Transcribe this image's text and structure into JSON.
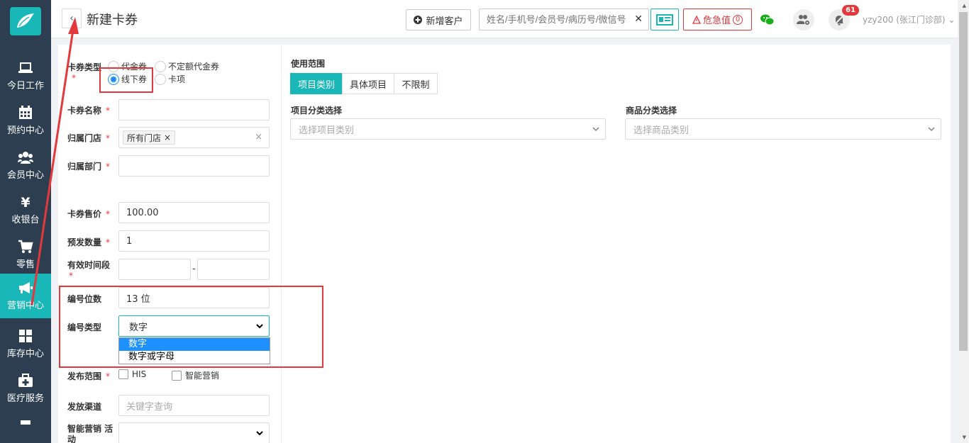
{
  "header": {
    "title": "新建卡券",
    "add_customer": "新增客户",
    "search_placeholder": "姓名/手机号/会员号/病历号/微信号",
    "critical_label": "危急值",
    "critical_count": "0",
    "notification_count": "61",
    "user": "yzy200 (张江门诊部)"
  },
  "sidebar": {
    "items": [
      {
        "label": "今日工作",
        "icon": "laptop-icon"
      },
      {
        "label": "预约中心",
        "icon": "calendar-icon"
      },
      {
        "label": "会员中心",
        "icon": "users-icon"
      },
      {
        "label": "收银台",
        "icon": "yen-icon"
      },
      {
        "label": "零售",
        "icon": "cart-icon"
      },
      {
        "label": "营销中心",
        "icon": "megaphone-icon",
        "active": true
      },
      {
        "label": "库存中心",
        "icon": "grid-icon"
      },
      {
        "label": "医疗服务",
        "icon": "medkit-icon"
      }
    ]
  },
  "form": {
    "card_type_label": "卡券类型",
    "card_types": [
      "代金券",
      "不定额代金券",
      "线下券",
      "卡项"
    ],
    "card_type_selected": "线下券",
    "name_label": "卡券名称",
    "store_label": "归属门店",
    "store_tag": "所有门店",
    "dept_label": "归属部门",
    "price_label": "卡券售价",
    "price_value": "100.00",
    "qty_label": "预发数量",
    "qty_value": "1",
    "period_label": "有效时间段",
    "period_sep": "-",
    "digits_label": "编号位数",
    "digits_value": "13 位",
    "numtype_label": "编号类型",
    "numtype_value": "数字",
    "numtype_options": [
      "数字",
      "数字或字母"
    ],
    "publish_label": "发布范围",
    "publish_options": [
      "HIS",
      "智能营销"
    ],
    "channel_label": "发放渠道",
    "channel_placeholder": "关键字查询",
    "activity_label": "智能营销 活动"
  },
  "scope": {
    "title": "使用范围",
    "tabs": [
      "项目类别",
      "具体项目",
      "不限制"
    ],
    "active_tab": "项目类别",
    "item_cat_label": "项目分类选择",
    "item_cat_placeholder": "选择项目类别",
    "goods_cat_label": "商品分类选择",
    "goods_cat_placeholder": "选择商品类别"
  },
  "colors": {
    "sidebar_bg": "#2d3e50",
    "accent": "#19b7b7",
    "danger": "#e4393c",
    "select_highlight": "#1e90ff"
  }
}
